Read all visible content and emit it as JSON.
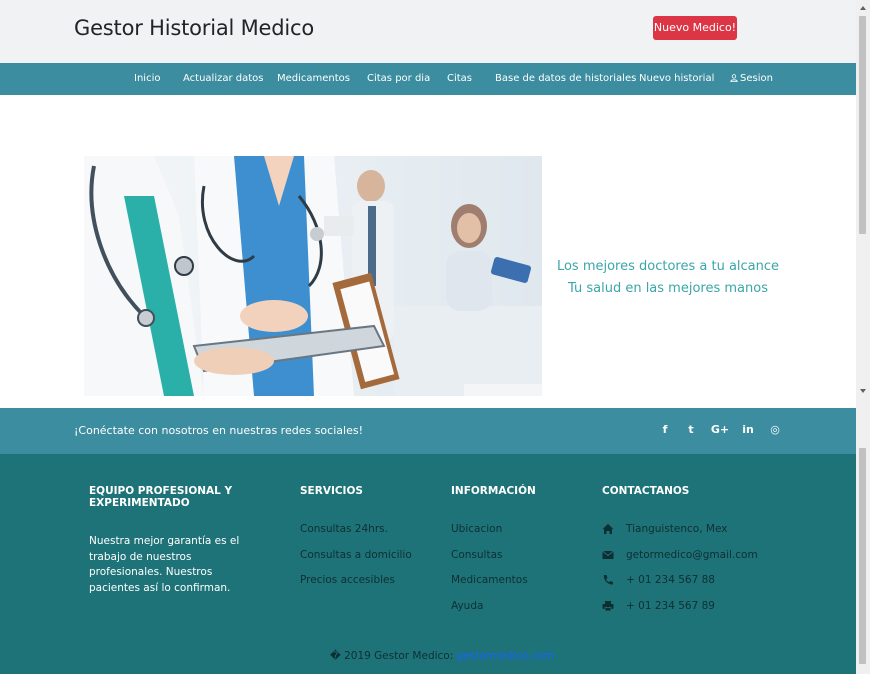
{
  "header": {
    "brand": "Gestor Historial Medico",
    "new_button": "Nuevo Medico!"
  },
  "nav": {
    "items": [
      {
        "label": "Inicio"
      },
      {
        "label": "Actualizar datos"
      },
      {
        "label": "Medicamentos"
      },
      {
        "label": "Citas por dia"
      },
      {
        "label": "Citas"
      },
      {
        "label": "Base de datos de historiales"
      },
      {
        "label": "Nuevo historial"
      },
      {
        "label": "Sesion",
        "icon": "user-icon"
      }
    ]
  },
  "hero": {
    "tagline_1": "Los mejores doctores a tu alcance",
    "tagline_2": "Tu salud en las mejores manos"
  },
  "social": {
    "text": "¡Conéctate con nosotros en nuestras redes sociales!",
    "icons": [
      "facebook-icon",
      "twitter-icon",
      "google-plus-icon",
      "linkedin-icon",
      "instagram-icon"
    ],
    "glyphs": [
      "f",
      "t",
      "G+",
      "in",
      "◎"
    ]
  },
  "footer": {
    "col1": {
      "title": "EQUIPO PROFESIONAL Y EXPERIMENTADO",
      "text": "Nuestra mejor garantía es el trabajo de nuestros profesionales. Nuestros pacientes así lo confirman."
    },
    "col2": {
      "title": "SERVICIOS",
      "links": [
        "Consultas 24hrs.",
        "Consultas a domicilio",
        "Precios accesibles"
      ]
    },
    "col3": {
      "title": "INFORMACIÓN",
      "links": [
        "Ubicacion",
        "Consultas",
        "Medicamentos",
        "Ayuda"
      ]
    },
    "col4": {
      "title": "CONTACTANOS",
      "items": [
        {
          "icon": "home-icon",
          "text": "Tianguistenco, Mex"
        },
        {
          "icon": "envelope-icon",
          "text": "getormedico@gmail.com"
        },
        {
          "icon": "phone-icon",
          "text": "+ 01 234 567 88"
        },
        {
          "icon": "printer-icon",
          "text": "+ 01 234 567 89"
        }
      ]
    },
    "copyright_prefix": "� 2019 Gestor Medico:",
    "copyright_link": "gestormedico.com"
  },
  "colors": {
    "nav_bg": "#3c8d9f",
    "footer_bg": "#1e7378",
    "button_red": "#dc3545",
    "tagline": "#3aa6a8"
  }
}
